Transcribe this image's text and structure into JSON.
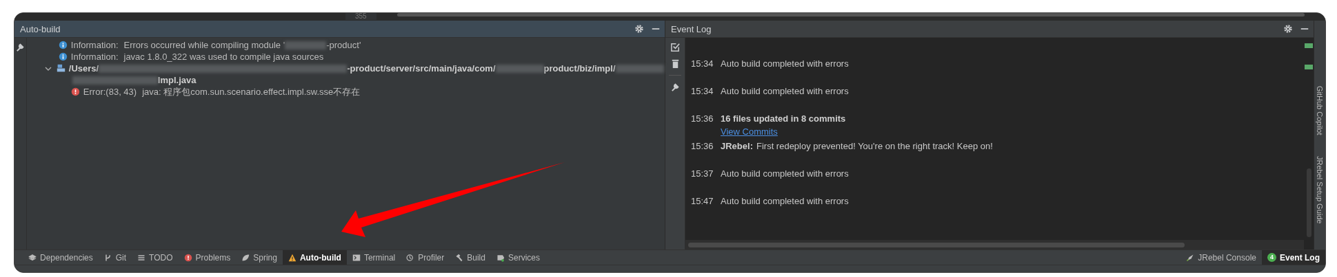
{
  "editor_strip": {
    "line_number": "355"
  },
  "build_panel": {
    "title": "Auto-build",
    "messages": [
      {
        "kind": "info",
        "label": "Information:",
        "segments": [
          {
            "kind": "text",
            "text": "Errors occurred while compiling module '"
          },
          {
            "kind": "redacted"
          },
          {
            "kind": "text",
            "text": "-product'"
          }
        ]
      },
      {
        "kind": "info",
        "label": "Information:",
        "segments": [
          {
            "kind": "text",
            "text": "javac 1.8.0_322 was used to compile java sources"
          }
        ]
      },
      {
        "kind": "file",
        "expanded": true,
        "segments": [
          {
            "kind": "text",
            "text": "/Users/"
          },
          {
            "kind": "redacted"
          },
          {
            "kind": "text",
            "text": "-product/server/src/main/java/com/"
          },
          {
            "kind": "redacted"
          },
          {
            "kind": "text",
            "text": "product/biz/impl/"
          },
          {
            "kind": "redacted"
          }
        ],
        "segments2": [
          {
            "kind": "redacted"
          },
          {
            "kind": "text",
            "text": "Impl.java"
          }
        ],
        "children": [
          {
            "kind": "error",
            "label": "Error:(83, 43)",
            "segments": [
              {
                "kind": "text",
                "text": "java: 程序包com.sun.scenario.effect.impl.sw.sse不存在"
              }
            ]
          }
        ]
      }
    ]
  },
  "event_log": {
    "title": "Event Log",
    "entries": [
      {
        "time": "15:34",
        "text": "Auto build completed with errors"
      },
      {
        "time": "15:34",
        "text": "Auto build completed with errors"
      },
      {
        "time": "15:36",
        "bold": "16 files updated in 8 commits",
        "link": "View Commits"
      },
      {
        "time": "15:36",
        "bold": "JRebel:",
        "text": "First redeploy prevented! You're on the right track! Keep on!"
      },
      {
        "time": "15:37",
        "text": "Auto build completed with errors"
      },
      {
        "time": "15:47",
        "text": "Auto build completed with errors"
      }
    ]
  },
  "side_strip": [
    "GitHub Copilot",
    "JRebel Setup Guide"
  ],
  "toolbar": {
    "tabs": [
      {
        "kind": "layers",
        "label": "Dependencies",
        "selected": false
      },
      {
        "kind": "git",
        "label": "Git",
        "selected": false
      },
      {
        "kind": "list",
        "label": "TODO",
        "selected": false
      },
      {
        "kind": "problem",
        "label": "Problems",
        "selected": false
      },
      {
        "kind": "leaf",
        "label": "Spring",
        "selected": false
      },
      {
        "kind": "warning",
        "label": "Auto-build",
        "selected": true
      },
      {
        "kind": "terminal",
        "label": "Terminal",
        "selected": false
      },
      {
        "kind": "profiler",
        "label": "Profiler",
        "selected": false
      },
      {
        "kind": "hammer",
        "label": "Build",
        "selected": false
      },
      {
        "kind": "services",
        "label": "Services",
        "selected": false
      }
    ],
    "right_tabs": [
      {
        "kind": "rocket",
        "label": "JRebel Console",
        "selected": false
      },
      {
        "kind": "badge",
        "badge": "4",
        "label": "Event Log",
        "selected": true
      }
    ]
  }
}
